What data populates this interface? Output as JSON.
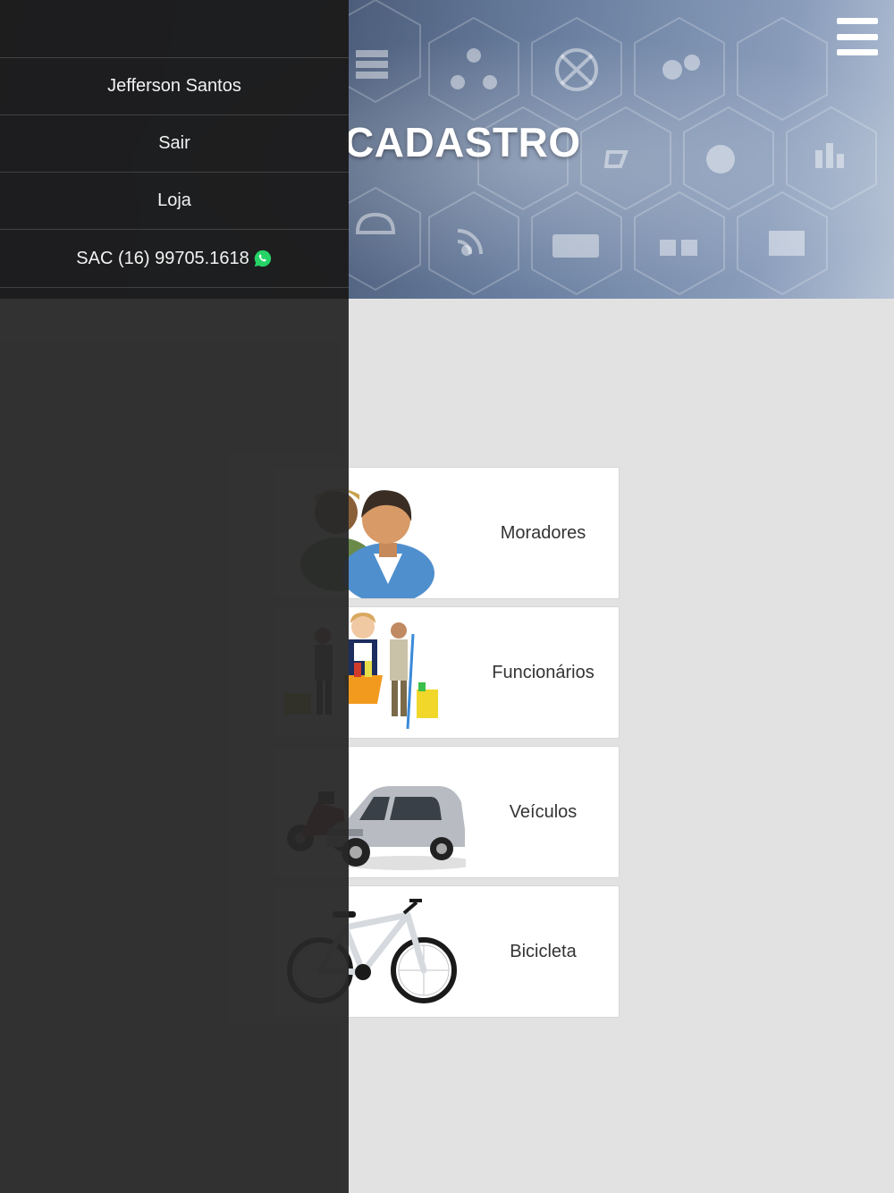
{
  "header": {
    "title": "CADASTRO",
    "menu_icon": "hamburger-icon"
  },
  "cards": [
    {
      "label": "Moradores",
      "icon": "residents-icon"
    },
    {
      "label": "Funcionários",
      "icon": "employees-icon"
    },
    {
      "label": "Veículos",
      "icon": "vehicles-icon"
    },
    {
      "label": "Bicicleta",
      "icon": "bicycle-icon"
    }
  ],
  "drawer": {
    "items": [
      {
        "label": "Jefferson Santos"
      },
      {
        "label": "Sair"
      },
      {
        "label": "Loja"
      },
      {
        "label": "SAC (16) 99705.1618",
        "icon": "whatsapp-icon"
      }
    ]
  },
  "colors": {
    "page_background": "#e2e2e2",
    "drawer_background": "#282828",
    "card_background": "#ffffff",
    "whatsapp_green": "#25d366"
  }
}
